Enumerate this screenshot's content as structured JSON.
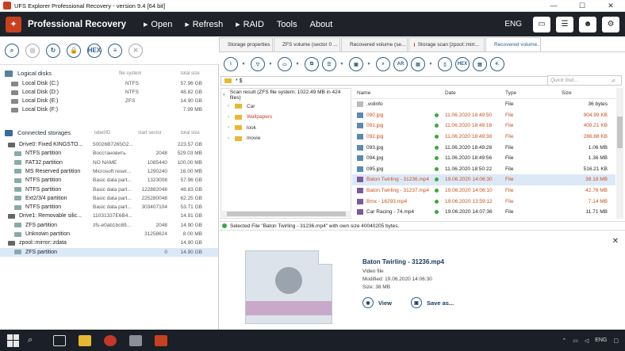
{
  "window": {
    "title": "UFS Explorer Professional Recovery - version 9.4 [64 bit]"
  },
  "menu": {
    "brand": "Professional Recovery",
    "items": [
      {
        "label": "Open",
        "arrow": true
      },
      {
        "label": "Refresh",
        "arrow": true
      },
      {
        "label": "RAID",
        "arrow": true
      },
      {
        "label": "Tools",
        "arrow": false
      },
      {
        "label": "About",
        "arrow": false
      }
    ],
    "lang": "ENG"
  },
  "left": {
    "logical_title": "Logical disks",
    "logical_cols": {
      "fs": "file system",
      "size": "total size"
    },
    "logical": [
      {
        "name": "Local Disk (C:)",
        "fs": "NTFS",
        "size": "57.96 GB"
      },
      {
        "name": "Local Disk (D:)",
        "fs": "NTFS",
        "size": "48.82 GB"
      },
      {
        "name": "Local Disk (E:)",
        "fs": "ZFS",
        "size": "14.90 GB"
      },
      {
        "name": "Local Disk (F:)",
        "fs": "",
        "size": "7.99 MB"
      }
    ],
    "connected_title": "Connected storages",
    "connected_cols": {
      "label": "label/ID",
      "start": "start sector",
      "size": "total size"
    },
    "connected": [
      {
        "name": "Drive0: Fixed KINGSTO...",
        "label": "50026B7265G2...",
        "start": "",
        "size": "223.57 GB",
        "level": 0,
        "sel": false
      },
      {
        "name": "NTFS partition",
        "label": "Восстановить",
        "start": "2048",
        "size": "529.03 MB",
        "level": 1,
        "sel": false
      },
      {
        "name": "FAT32 partition",
        "label": "NO NAME",
        "start": "1085440",
        "size": "100.00 MB",
        "level": 1,
        "sel": false
      },
      {
        "name": "MS Reserved partition",
        "label": "Microsoft reser...",
        "start": "1290240",
        "size": "16.00 MB",
        "level": 1,
        "sel": false
      },
      {
        "name": "NTFS partition",
        "label": "Basic data part...",
        "start": "1323008",
        "size": "57.96 GB",
        "level": 1,
        "sel": false
      },
      {
        "name": "NTFS partition",
        "label": "Basic data part...",
        "start": "122882048",
        "size": "48.83 GB",
        "level": 1,
        "sel": false
      },
      {
        "name": "Ext2/3/4 partition",
        "label": "Basic data part...",
        "start": "225280048",
        "size": "62.25 GB",
        "level": 1,
        "sel": false
      },
      {
        "name": "NTFS partition",
        "label": "Basic data part...",
        "start": "303407104",
        "size": "53.71 GB",
        "level": 1,
        "sel": false
      },
      {
        "name": "Drive1: Removable silic...",
        "label": "11031337E6B4...",
        "start": "",
        "size": "14.91 GB",
        "level": 0,
        "sel": false
      },
      {
        "name": "ZFS partition",
        "label": "zfs-e0ab1bc89...",
        "start": "2048",
        "size": "14.90 GB",
        "level": 1,
        "sel": false
      },
      {
        "name": "Unknown partition",
        "label": "",
        "start": "31258624",
        "size": "8.00 MB",
        "level": 1,
        "sel": false
      },
      {
        "name": "zpool::mirror::zdata",
        "label": "",
        "start": "",
        "size": "14.90 GB",
        "level": 0,
        "sel": false
      },
      {
        "name": "ZFS partition",
        "label": "",
        "start": "0",
        "size": "14.90 GB",
        "level": 1,
        "sel": true
      }
    ]
  },
  "tabs": [
    {
      "label": "Storage properties",
      "active": false,
      "dot": "#888888"
    },
    {
      "label": "ZFS volume (sector 0 ...",
      "active": false,
      "dot": "#888888"
    },
    {
      "label": "Recovered volume (se...",
      "active": false,
      "dot": "#c8401e"
    },
    {
      "label": "Storage scan [zpool::mirr...",
      "active": false,
      "dot": "#c8401e"
    },
    {
      "label": "Recovered volume...",
      "active": true,
      "dot": "#e8b830"
    }
  ],
  "toolbar": {
    "ar_label": "AR",
    "hex_label": "HEX",
    "hash_label": "#.",
    "quickfind_placeholder": "Quick find..."
  },
  "path": {
    "value": "* $"
  },
  "tree": {
    "root": "Scan result (ZFS file system; 1022.49 MB in 424 files)",
    "folders": [
      {
        "name": "Car",
        "color": "#333333"
      },
      {
        "name": "Wallpapers",
        "color": "#c8401e"
      },
      {
        "name": "look",
        "color": "#333333"
      },
      {
        "name": "movie",
        "color": "#333333"
      }
    ]
  },
  "grid": {
    "headers": {
      "name": "Name",
      "date": "Date",
      "type": "Type",
      "size": "Size"
    },
    "rows": [
      {
        "name": ".volinfo",
        "date": "",
        "type": "File",
        "size": "36 bytes",
        "dot": false,
        "sel": false,
        "orange": false
      },
      {
        "name": "090.jpg",
        "date": "11.06.2020 18:49:50",
        "type": "File",
        "size": "904.99 KB",
        "dot": true,
        "sel": false,
        "orange": true
      },
      {
        "name": "091.jpg",
        "date": "11.06.2020 18:49:18",
        "type": "File",
        "size": "409.21 KB",
        "dot": true,
        "sel": false,
        "orange": true
      },
      {
        "name": "092.jpg",
        "date": "11.06.2020 18:49:38",
        "type": "File",
        "size": "286.88 KB",
        "dot": true,
        "sel": false,
        "orange": true
      },
      {
        "name": "093.jpg",
        "date": "11.06.2020 18:49:28",
        "type": "File",
        "size": "1.06 MB",
        "dot": true,
        "sel": false,
        "orange": false
      },
      {
        "name": "094.jpg",
        "date": "11.06.2020 18:49:56",
        "type": "File",
        "size": "1.36 MB",
        "dot": true,
        "sel": false,
        "orange": false
      },
      {
        "name": "095.jpg",
        "date": "11.06.2020 18:50:22",
        "type": "File",
        "size": "516.21 KB",
        "dot": true,
        "sel": false,
        "orange": false
      },
      {
        "name": "Baton Twirling - 31236.mp4",
        "date": "19.06.2020 14:06:30",
        "type": "File",
        "size": "38.18 MB",
        "dot": true,
        "sel": true,
        "orange": true
      },
      {
        "name": "Baton Twirling - 31237.mp4",
        "date": "19.06.2020 14:06:10",
        "type": "File",
        "size": "42.76 MB",
        "dot": true,
        "sel": false,
        "orange": true
      },
      {
        "name": "Bmx - 16293.mp4",
        "date": "19.06.2020 13:59:12",
        "type": "File",
        "size": "7.14 MB",
        "dot": true,
        "sel": false,
        "orange": true
      },
      {
        "name": "Car Racing - 74.mp4",
        "date": "19.06.2020 14:07:36",
        "type": "File",
        "size": "11.71 MB",
        "dot": true,
        "sel": false,
        "orange": false
      }
    ]
  },
  "status": {
    "text": "Selected File \"Baton Twirling - 31236.mp4\" with own size 40040205 bytes."
  },
  "preview": {
    "name": "Baton Twirling - 31236.mp4",
    "kind": "Video file",
    "modified": "Modified: 19.06.2020 14:06:30",
    "size": "Size: 38 MB",
    "view_label": "View",
    "saveas_label": "Save as..."
  },
  "taskbar": {
    "lang": "ENG"
  }
}
